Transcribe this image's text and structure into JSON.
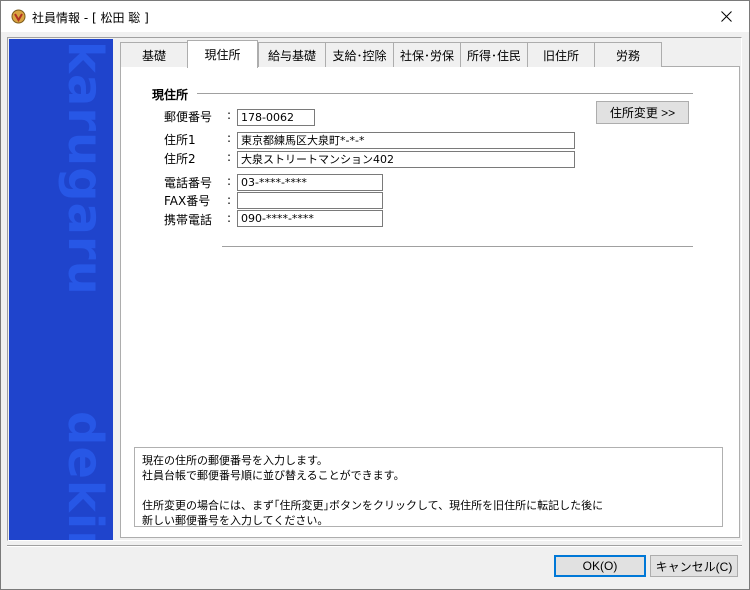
{
  "window": {
    "title": "社員情報 - [ 松田 聡 ]"
  },
  "brand": {
    "top_word": "karugaru",
    "bottom_word": "dekiru"
  },
  "tabs": [
    {
      "label": "基礎",
      "active": false
    },
    {
      "label": "現住所",
      "active": true
    },
    {
      "label": "給与基礎",
      "active": false
    },
    {
      "label": "支給･控除",
      "active": false
    },
    {
      "label": "社保･労保",
      "active": false
    },
    {
      "label": "所得･住民",
      "active": false
    },
    {
      "label": "旧住所",
      "active": false
    },
    {
      "label": "労務",
      "active": false
    }
  ],
  "section": {
    "title": "現住所"
  },
  "form": {
    "colon": ":",
    "postal": {
      "label": "郵便番号",
      "value": "178-0062"
    },
    "address1": {
      "label": "住所1",
      "value": "東京都練馬区大泉町*-*-*"
    },
    "address2": {
      "label": "住所2",
      "value": "大泉ストリートマンション402"
    },
    "phone": {
      "label": "電話番号",
      "value": "03-****-****"
    },
    "fax": {
      "label": "FAX番号",
      "value": ""
    },
    "mobile": {
      "label": "携帯電話",
      "value": "090-****-****"
    }
  },
  "buttons": {
    "address_change": "住所変更 >>",
    "ok": "OK(O)",
    "cancel": "キャンセル(C)"
  },
  "help": {
    "lines": [
      "現在の住所の郵便番号を入力します。",
      "社員台帳で郵便番号順に並び替えることができます。",
      "",
      "住所変更の場合には、まず｢住所変更｣ボタンをクリックして、現住所を旧住所に転記した後に",
      "新しい郵便番号を入力してください。"
    ]
  }
}
